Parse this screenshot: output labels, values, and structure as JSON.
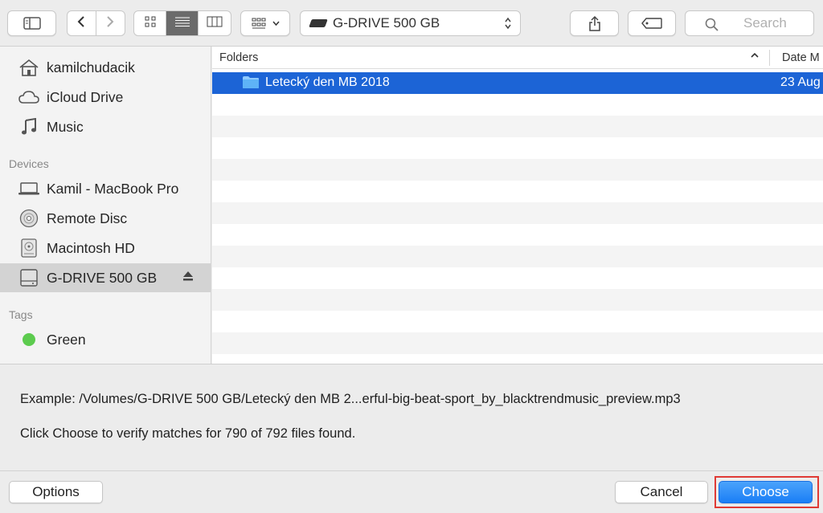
{
  "toolbar": {
    "path_popup_label": "G-DRIVE 500 GB",
    "search_placeholder": "Search"
  },
  "sidebar": {
    "favorites": [
      {
        "label": "kamilchudacik",
        "icon": "home-icon"
      },
      {
        "label": "iCloud Drive",
        "icon": "cloud-icon"
      },
      {
        "label": "Music",
        "icon": "music-note-icon"
      }
    ],
    "devices_header": "Devices",
    "devices": [
      {
        "label": "Kamil - MacBook Pro",
        "icon": "laptop-icon"
      },
      {
        "label": "Remote Disc",
        "icon": "disc-icon"
      },
      {
        "label": "Macintosh HD",
        "icon": "hard-drive-icon"
      },
      {
        "label": "G-DRIVE 500 GB",
        "icon": "external-drive-icon",
        "selected": true
      }
    ],
    "tags_header": "Tags",
    "tags": [
      {
        "label": "Green",
        "color": "#5ccb4e"
      }
    ]
  },
  "filelist": {
    "columns": {
      "name": "Folders",
      "date": "Date M"
    },
    "rows": [
      {
        "name": "Letecký den MB 2018",
        "date": "23 Aug",
        "selected": true
      }
    ]
  },
  "info": {
    "example": "Example: /Volumes/G-DRIVE 500 GB/Letecký den MB 2...erful-big-beat-sport_by_blacktrendmusic_preview.mp3",
    "message": "Click Choose to verify matches for 790 of 792 files found."
  },
  "buttons": {
    "options": "Options",
    "cancel": "Cancel",
    "choose": "Choose"
  },
  "colors": {
    "selection": "#1c64d6",
    "primary_button": "#1a7ef6",
    "highlight": "#e03a35"
  }
}
